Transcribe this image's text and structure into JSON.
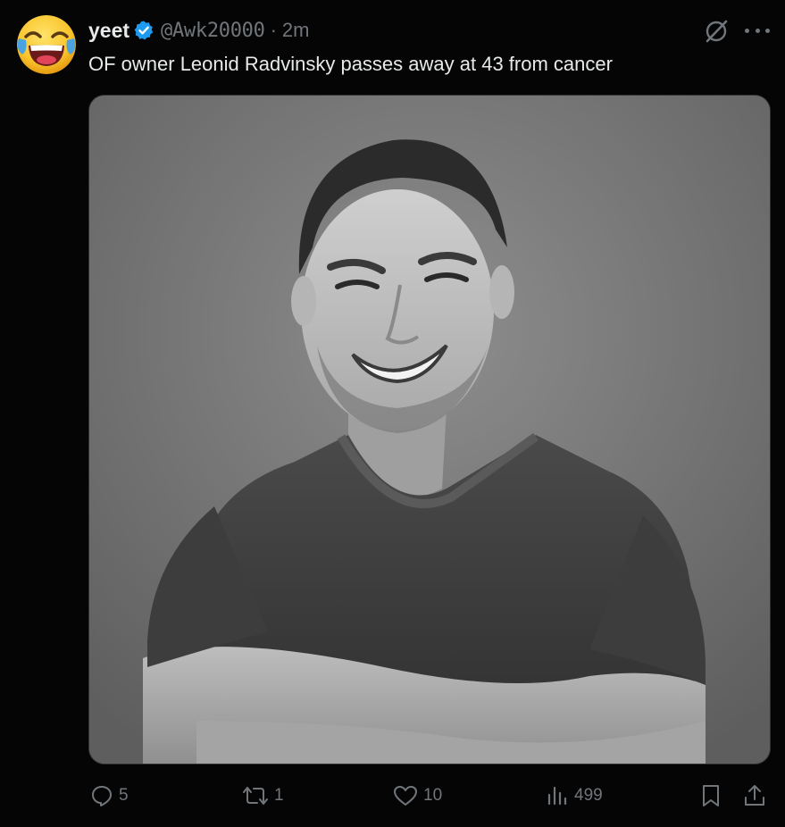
{
  "tweet": {
    "display_name": "yeet",
    "handle": "@Awk20000",
    "separator": "·",
    "time": "2m",
    "text": "OF owner Leonid Radvinsky passes away at 43 from cancer"
  },
  "icons": {
    "avatar": "face-with-tears-of-joy-emoji",
    "verified": "verified-badge-icon",
    "grok": "grok-icon",
    "more": "more-icon",
    "reply": "reply-icon",
    "retweet": "retweet-icon",
    "like": "like-icon",
    "views": "views-icon",
    "bookmark": "bookmark-icon",
    "share": "share-icon"
  },
  "colors": {
    "background": "#050505",
    "text": "#e7e9ea",
    "muted": "#71767b",
    "verified": "#1d9bf0"
  },
  "media": {
    "kind": "black-and-white portrait photo"
  },
  "actions": {
    "replies": "5",
    "retweets": "1",
    "likes": "10",
    "views": "499"
  }
}
